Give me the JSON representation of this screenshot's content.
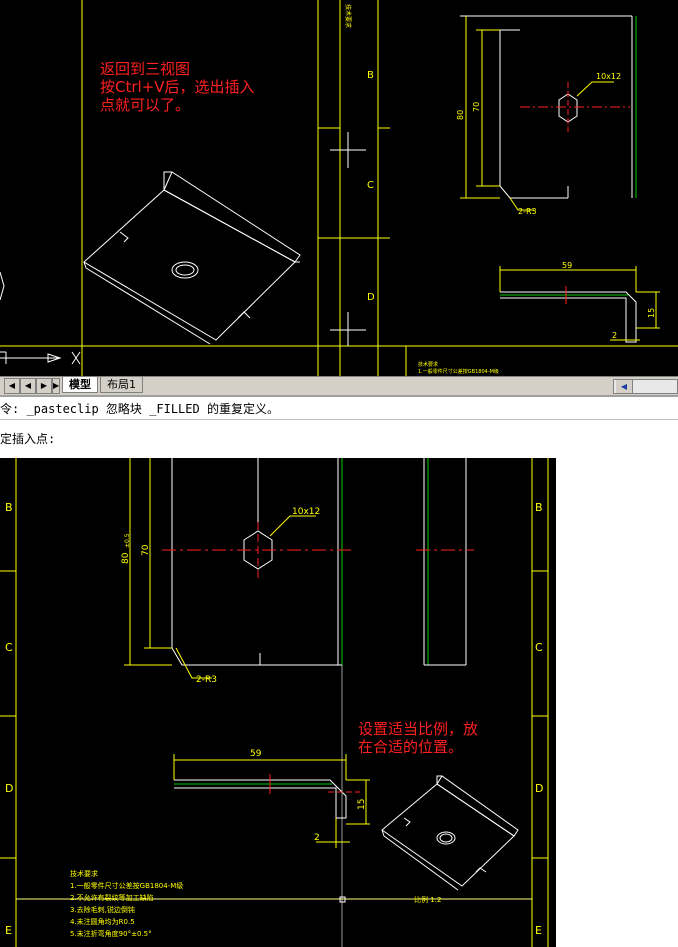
{
  "top_note": {
    "line1": "返回到三视图",
    "line2": "按Ctrl+V后，选出插入",
    "line3": "点就可以了。"
  },
  "bottom_note": {
    "line1": "设置适当比例，放",
    "line2": "在合适的位置。"
  },
  "border_letters_top": [
    "B",
    "C",
    "D"
  ],
  "border_letters_bottom": [
    "B",
    "C",
    "D",
    "E"
  ],
  "dims": {
    "hole": "10x12",
    "height_total": "80",
    "tol": "±0.5",
    "height_inner": "70",
    "radius": "2-R3",
    "width": "59",
    "side": "15",
    "thickness": "2"
  },
  "tech_notes": {
    "title": "技术要求",
    "items": [
      "1.一般零件尺寸公差按GB1804-M级",
      "2.不允许有裂纹等加工缺陷",
      "3.去除毛刺,锐边倒钝",
      "4.未注圆角均为R0.5",
      "5.未注折弯角度90°±0.5°"
    ]
  },
  "scale_label": "比例 1:2",
  "tabs": {
    "model": "模型",
    "layout1": "布局1"
  },
  "command": {
    "line1": "令: _pasteclip 忽略块 _FILLED 的重复定义。",
    "line2": "定插入点:"
  },
  "colors": {
    "cad_bg": "#000000",
    "yellow": "#ffff00",
    "white": "#ffffff",
    "red": "#ff2020",
    "green": "#00cc00"
  }
}
